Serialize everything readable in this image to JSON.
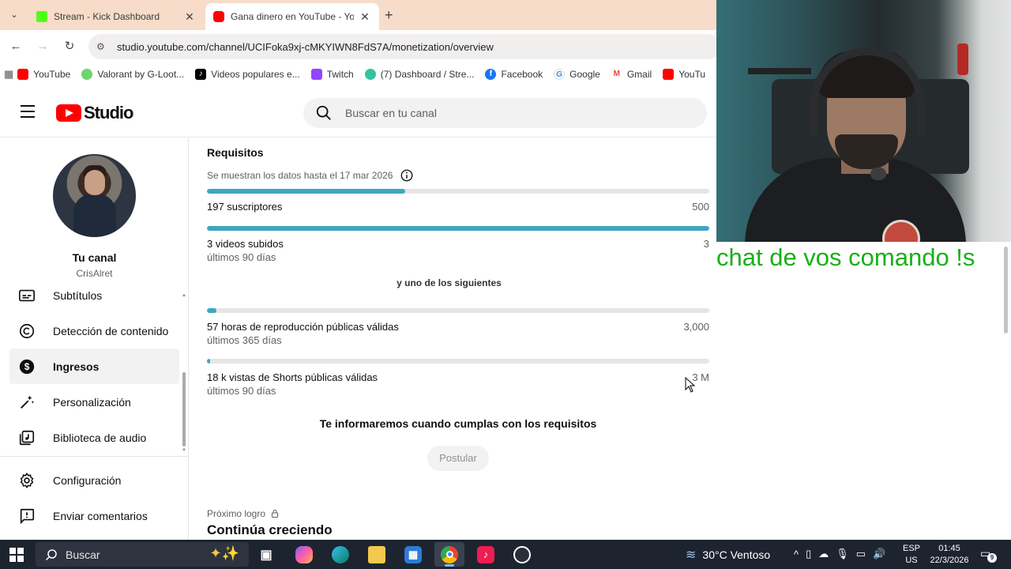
{
  "browser": {
    "tabs": [
      {
        "title": "Stream - Kick Dashboard",
        "favicon": "kick-icon",
        "active": false
      },
      {
        "title": "Gana dinero en YouTube - YouT",
        "favicon": "youtube-icon",
        "active": true
      }
    ],
    "url": "studio.youtube.com/channel/UCIFoka9xj-cMKYIWN8FdS7A/monetization/overview",
    "bookmarks": [
      {
        "label": "YouTube",
        "icon": "youtube-icon",
        "color": "#ff0000"
      },
      {
        "label": "Valorant by G-Loot...",
        "icon": "gloot-icon",
        "color": "#6fd36f"
      },
      {
        "label": "Videos populares e...",
        "icon": "tiktok-icon",
        "color": "#000000"
      },
      {
        "label": "Twitch",
        "icon": "twitch-icon",
        "color": "#9146ff"
      },
      {
        "label": "(7) Dashboard / Stre...",
        "icon": "streamlabs-icon",
        "color": "#31c3a2"
      },
      {
        "label": "Facebook",
        "icon": "facebook-icon",
        "color": "#1877f2"
      },
      {
        "label": "Google",
        "icon": "google-icon",
        "color": "#4285f4"
      },
      {
        "label": "Gmail",
        "icon": "gmail-icon",
        "color": "#ea4335"
      },
      {
        "label": "YouTu",
        "icon": "youtube-icon",
        "color": "#ff0000"
      }
    ]
  },
  "studio": {
    "logo_text": "Studio",
    "search_placeholder": "Buscar en tu canal",
    "channel": {
      "name": "Tu canal",
      "handle": "CrisAlret"
    },
    "nav": [
      {
        "label": "Subtítulos",
        "icon": "subtitles-icon",
        "active": false
      },
      {
        "label": "Detección de contenido",
        "icon": "copyright-icon",
        "active": false
      },
      {
        "label": "Ingresos",
        "icon": "dollar-icon",
        "active": true
      },
      {
        "label": "Personalización",
        "icon": "magic-wand-icon",
        "active": false
      },
      {
        "label": "Biblioteca de audio",
        "icon": "audio-library-icon",
        "active": false
      }
    ],
    "nav_bottom": [
      {
        "label": "Configuración",
        "icon": "gear-icon"
      },
      {
        "label": "Enviar comentarios",
        "icon": "feedback-icon"
      }
    ]
  },
  "requirements": {
    "title": "Requisitos",
    "data_note": "Se muestran los datos hasta el 17 mar 2026",
    "items": [
      {
        "label": "197 suscriptores",
        "sub": "",
        "target": "500",
        "progress": 0.394
      },
      {
        "label": "3 videos subidos",
        "sub": "últimos 90 días",
        "target": "3",
        "progress": 1.0
      }
    ],
    "or_text": "y uno de los siguientes",
    "alt_items": [
      {
        "label": "57 horas de reproducción públicas válidas",
        "sub": "últimos 365 días",
        "target": "3,000",
        "progress": 0.019
      },
      {
        "label": "18 k vistas de Shorts públicas válidas",
        "sub": "últimos 90 días",
        "target": "3 M",
        "progress": 0.006
      }
    ],
    "notify_text": "Te informaremos cuando cumplas con los requisitos",
    "apply_label": "Postular",
    "next_label": "Próximo logro",
    "next_title": "Continúa creciendo"
  },
  "overlay": {
    "chat_command": "chat de vos comando !s"
  },
  "taskbar": {
    "search_text": "Buscar",
    "weather": "30°C  Ventoso",
    "lang_line1": "ESP",
    "lang_line2": "US",
    "time": "01:45",
    "date": "22/3/2026",
    "notification_count": "9"
  }
}
